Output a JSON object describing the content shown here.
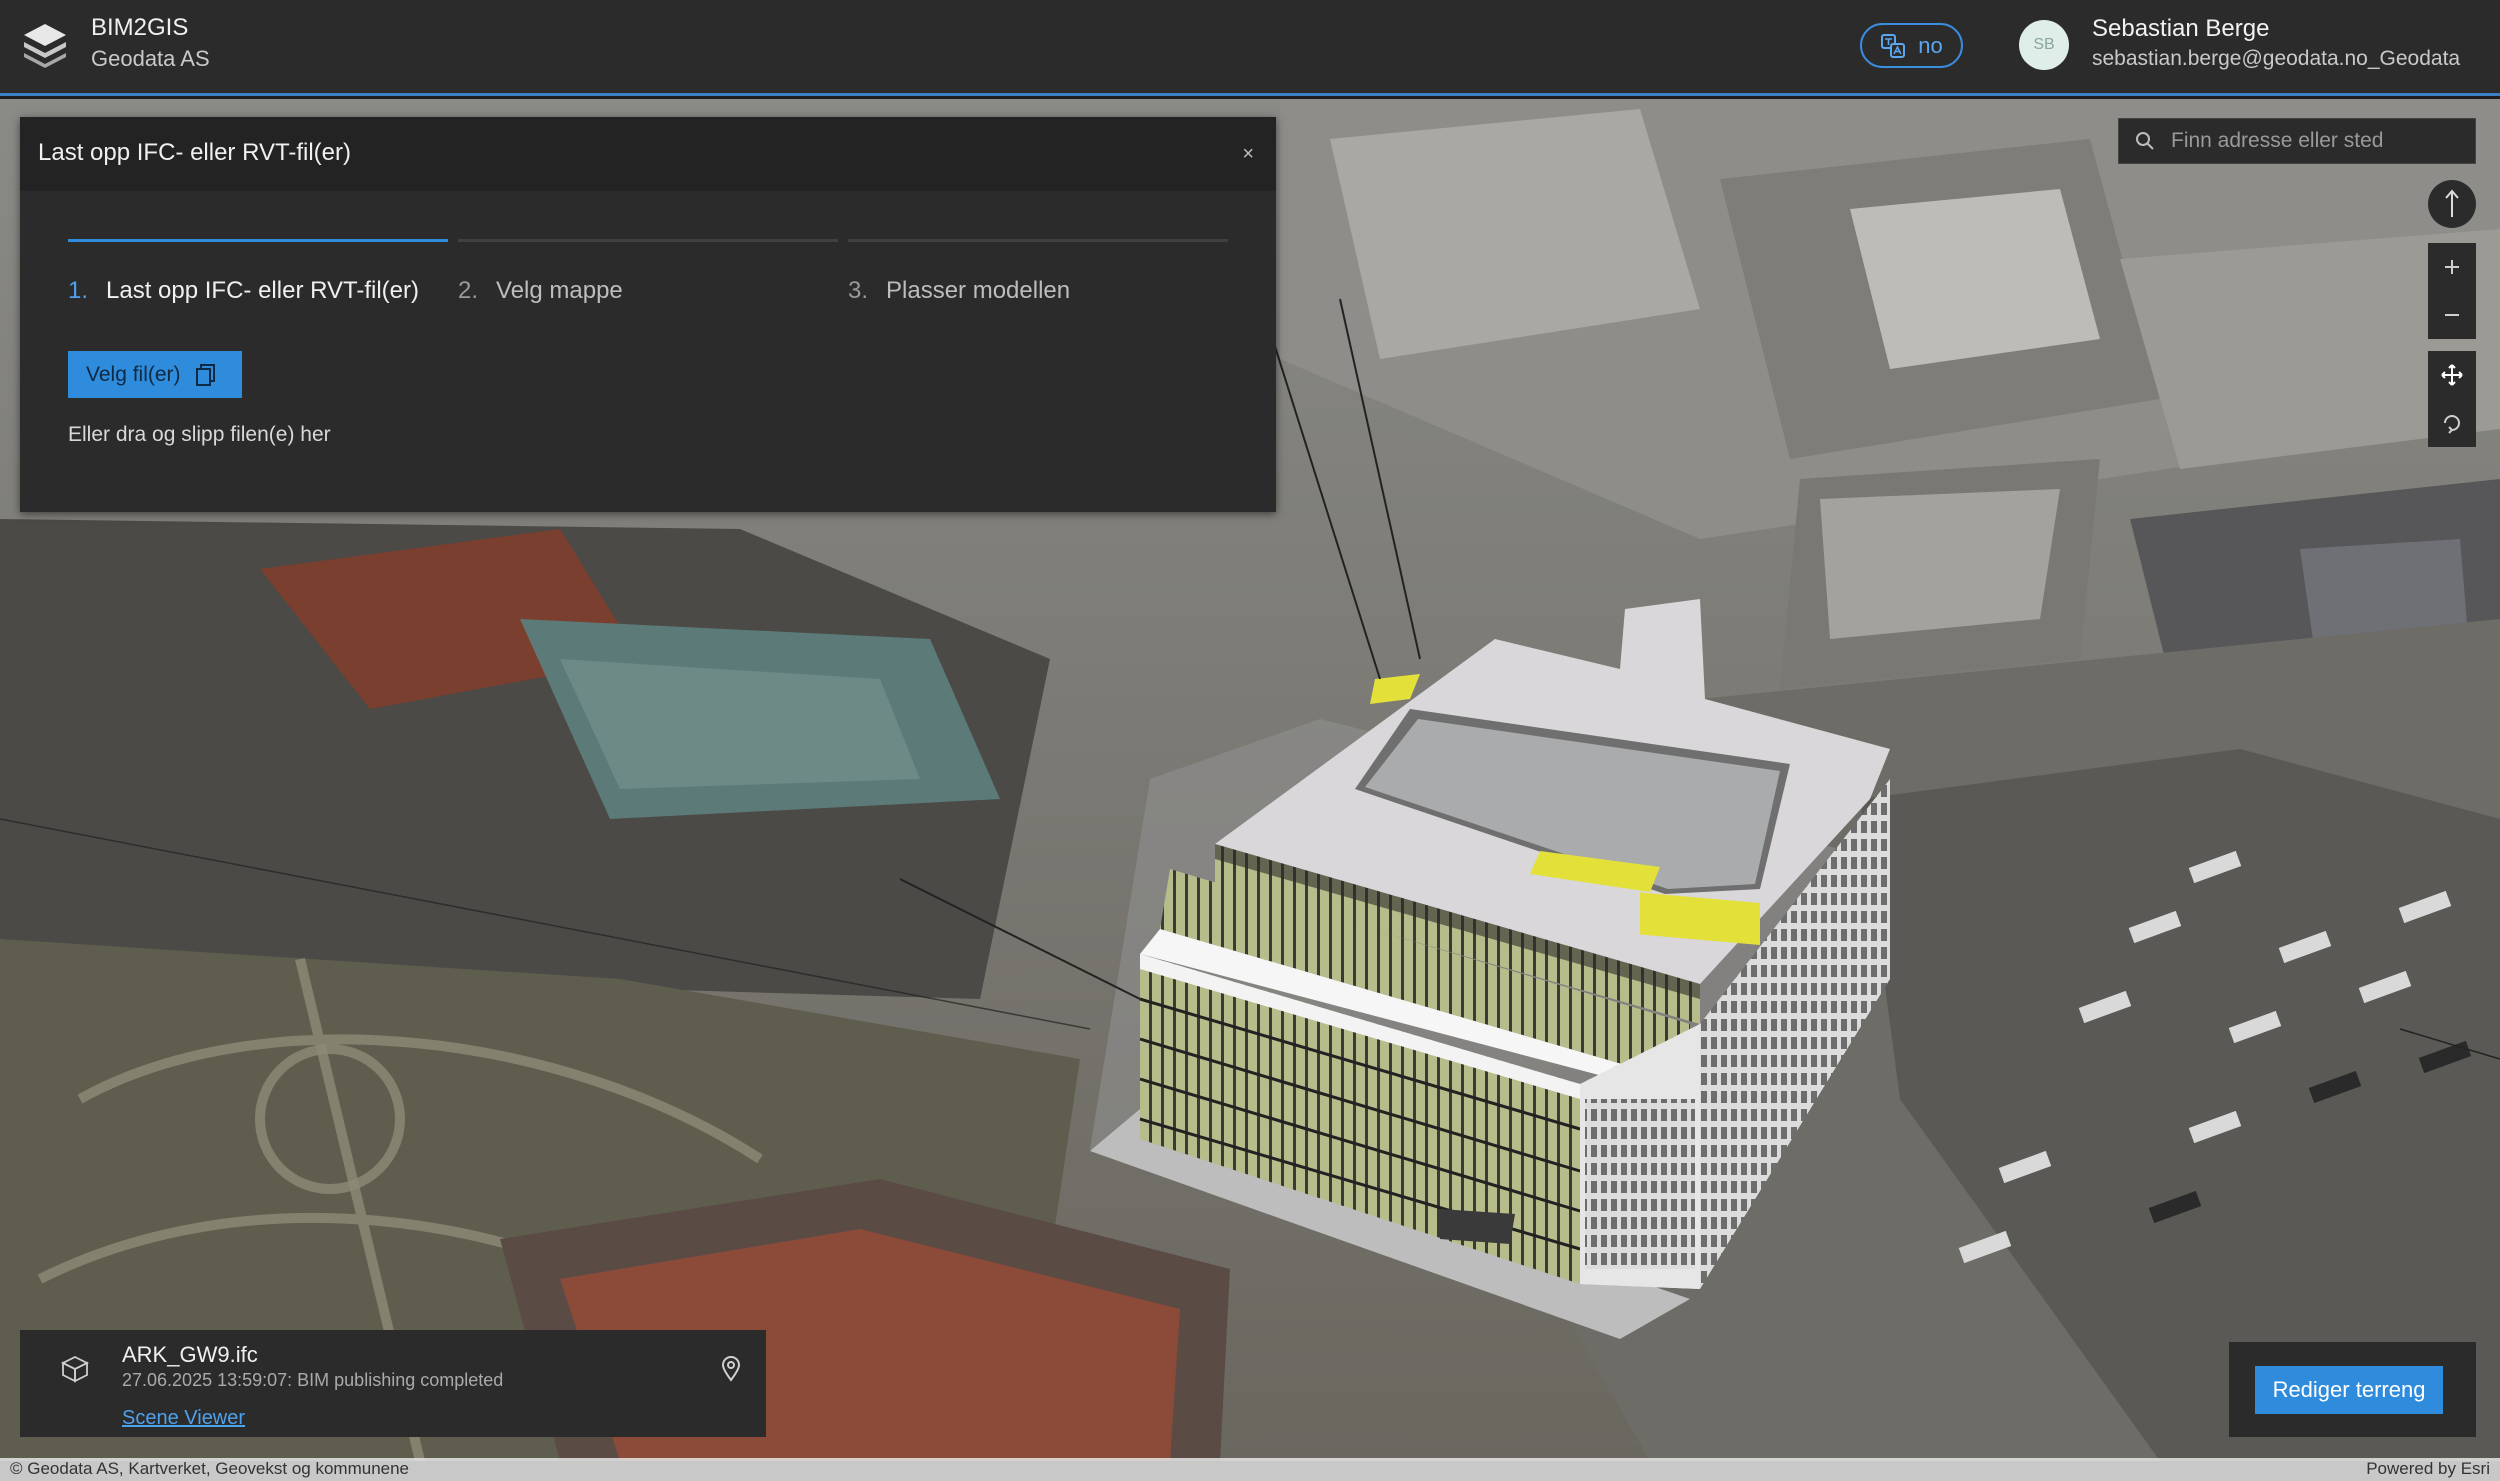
{
  "header": {
    "app_title": "BIM2GIS",
    "org_name": "Geodata AS",
    "language": "no",
    "avatar_initials": "SB",
    "user_name": "Sebastian Berge",
    "user_email": "sebastian.berge@geodata.no_Geodata"
  },
  "upload_panel": {
    "title": "Last opp IFC- eller RVT-fil(er)",
    "close_glyph": "×",
    "steps": [
      {
        "num": "1.",
        "label": "Last opp IFC- eller RVT-fil(er)",
        "active": true
      },
      {
        "num": "2.",
        "label": "Velg mappe",
        "active": false
      },
      {
        "num": "3.",
        "label": "Plasser modellen",
        "active": false
      }
    ],
    "choose_button": "Velg fil(er)",
    "drop_hint": "Eller dra og slipp filen(e) her"
  },
  "search": {
    "placeholder": "Finn adresse eller sted"
  },
  "map_tools": [
    {
      "name": "compass-button",
      "icon": "north-arrow-icon"
    },
    {
      "name": "zoom-in-button",
      "icon": "plus-icon"
    },
    {
      "name": "zoom-out-button",
      "icon": "minus-icon"
    },
    {
      "name": "pan-button",
      "icon": "move-icon"
    },
    {
      "name": "rotate-button",
      "icon": "rotate-icon"
    }
  ],
  "model_card": {
    "file_name": "ARK_GW9.ifc",
    "status": "27.06.2025 13:59:07: BIM publishing completed",
    "link": "Scene Viewer"
  },
  "terrain_button": "Rediger terreng",
  "attribution": "© Geodata AS, Kartverket, Geovekst og kommunene",
  "powered_by": "Powered by Esri",
  "colors": {
    "accent": "#2f8bdc",
    "header_bg": "#2b2b2b",
    "panel_bg": "#2b2b2b",
    "highlight_yellow": "#e3e03a"
  }
}
